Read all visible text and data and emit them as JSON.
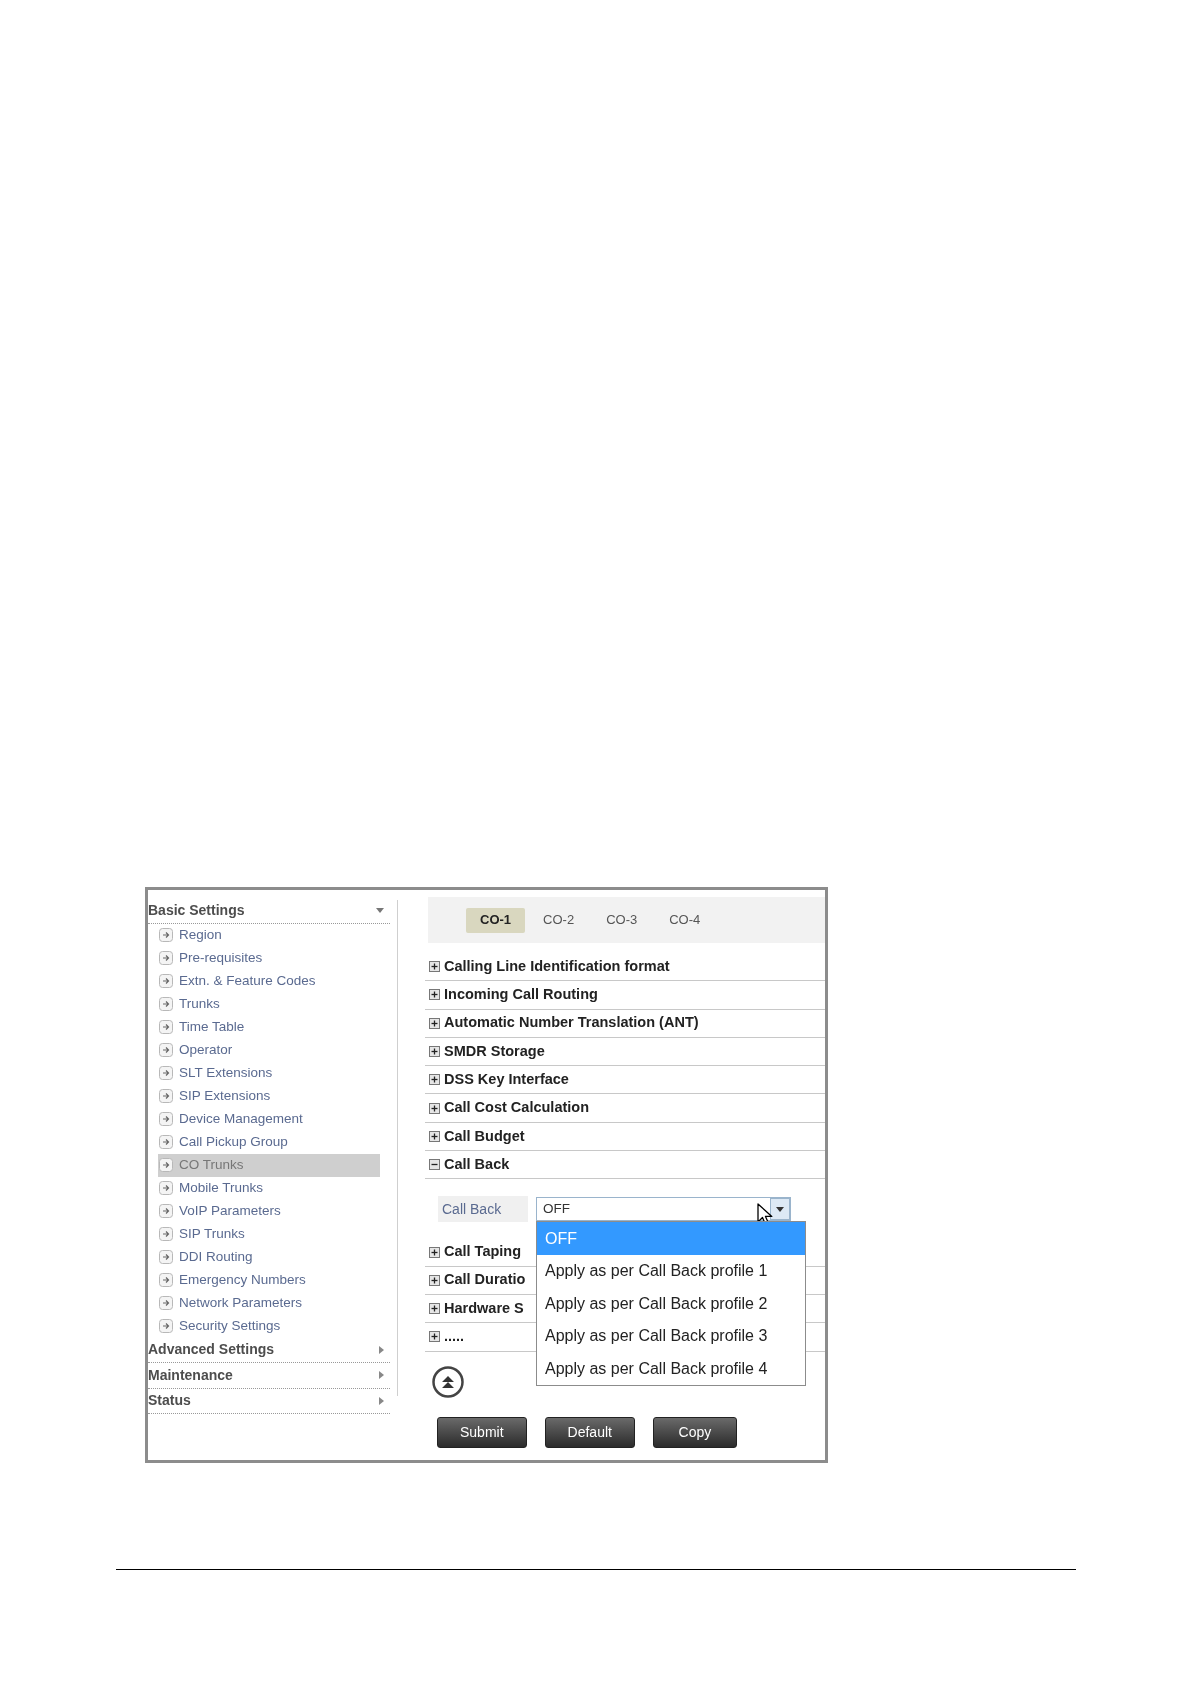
{
  "sidebar": {
    "groups": [
      {
        "title": "Basic Settings",
        "expanded": true,
        "items": [
          {
            "label": "Region",
            "selected": false
          },
          {
            "label": "Pre-requisites",
            "selected": false
          },
          {
            "label": "Extn. & Feature Codes",
            "selected": false
          },
          {
            "label": "Trunks",
            "selected": false
          },
          {
            "label": "Time Table",
            "selected": false
          },
          {
            "label": "Operator",
            "selected": false
          },
          {
            "label": "SLT Extensions",
            "selected": false
          },
          {
            "label": "SIP Extensions",
            "selected": false
          },
          {
            "label": "Device Management",
            "selected": false
          },
          {
            "label": "Call Pickup Group",
            "selected": false
          },
          {
            "label": "CO Trunks",
            "selected": true
          },
          {
            "label": "Mobile Trunks",
            "selected": false
          },
          {
            "label": "VoIP Parameters",
            "selected": false
          },
          {
            "label": "SIP Trunks",
            "selected": false
          },
          {
            "label": "DDI Routing",
            "selected": false
          },
          {
            "label": "Emergency Numbers",
            "selected": false
          },
          {
            "label": "Network Parameters",
            "selected": false
          },
          {
            "label": "Security Settings",
            "selected": false
          }
        ]
      },
      {
        "title": "Advanced Settings",
        "expanded": false
      },
      {
        "title": "Maintenance",
        "expanded": false
      },
      {
        "title": "Status",
        "expanded": false
      }
    ]
  },
  "tabs": [
    {
      "label": "CO-1",
      "selected": true
    },
    {
      "label": "CO-2",
      "selected": false
    },
    {
      "label": "CO-3",
      "selected": false
    },
    {
      "label": "CO-4",
      "selected": false
    }
  ],
  "sections": [
    {
      "title": "Calling Line Identification format",
      "expanded": false
    },
    {
      "title": "Incoming Call Routing",
      "expanded": false
    },
    {
      "title": "Automatic Number Translation (ANT)",
      "expanded": false
    },
    {
      "title": "SMDR Storage",
      "expanded": false
    },
    {
      "title": "DSS Key Interface",
      "expanded": false
    },
    {
      "title": "Call Cost Calculation",
      "expanded": false
    },
    {
      "title": "Call Budget",
      "expanded": false
    },
    {
      "title": "Call Back",
      "expanded": true,
      "field": {
        "label": "Call Back",
        "value": "OFF",
        "open": true,
        "options": [
          {
            "label": "OFF",
            "selected": true
          },
          {
            "label": "Apply as per Call Back profile 1",
            "selected": false
          },
          {
            "label": "Apply as per Call Back profile 2",
            "selected": false
          },
          {
            "label": "Apply as per Call Back profile 3",
            "selected": false
          },
          {
            "label": "Apply as per Call Back profile 4",
            "selected": false
          }
        ]
      }
    },
    {
      "title": "Call Taping",
      "expanded": false
    },
    {
      "title": "Call Duratio",
      "expanded": false
    },
    {
      "title": "Hardware S",
      "expanded": false
    },
    {
      "title": ".....",
      "expanded": false
    }
  ],
  "buttons": [
    "Submit",
    "Default",
    "Copy"
  ]
}
